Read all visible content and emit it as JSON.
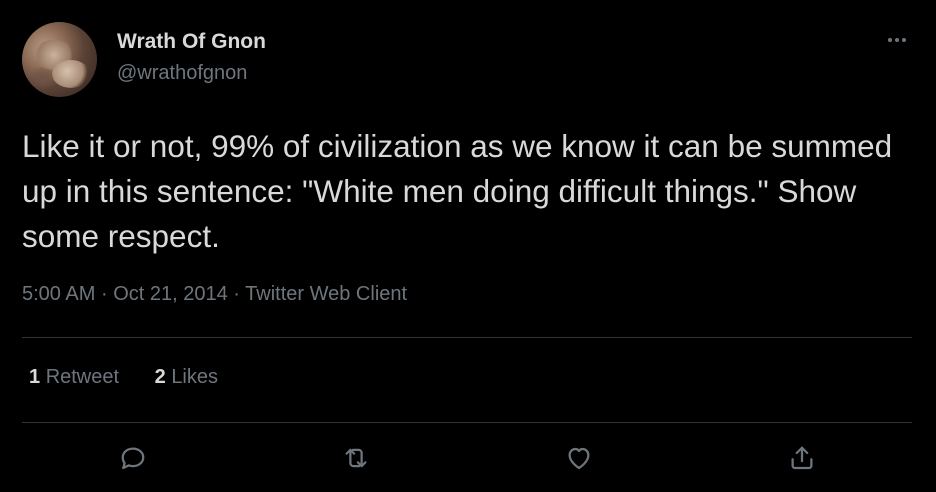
{
  "author": {
    "name": "Wrath Of Gnon",
    "handle": "@wrathofgnon"
  },
  "tweet": {
    "text": "Like it or not, 99% of civilization as we know it can be summed up in this sentence: \"White men doing difficult things.\" Show some respect.",
    "time": "5:00 AM",
    "date": "Oct 21, 2014",
    "source": "Twitter Web Client",
    "separator": "·"
  },
  "stats": {
    "retweets_count": "1",
    "retweets_label": "Retweet",
    "likes_count": "2",
    "likes_label": "Likes"
  },
  "actions": [
    "reply-icon",
    "retweet-icon",
    "like-icon",
    "share-icon"
  ],
  "colors": {
    "background": "#000000",
    "text": "#d9d9d9",
    "muted": "#6e767d",
    "divider": "#2f3336"
  }
}
